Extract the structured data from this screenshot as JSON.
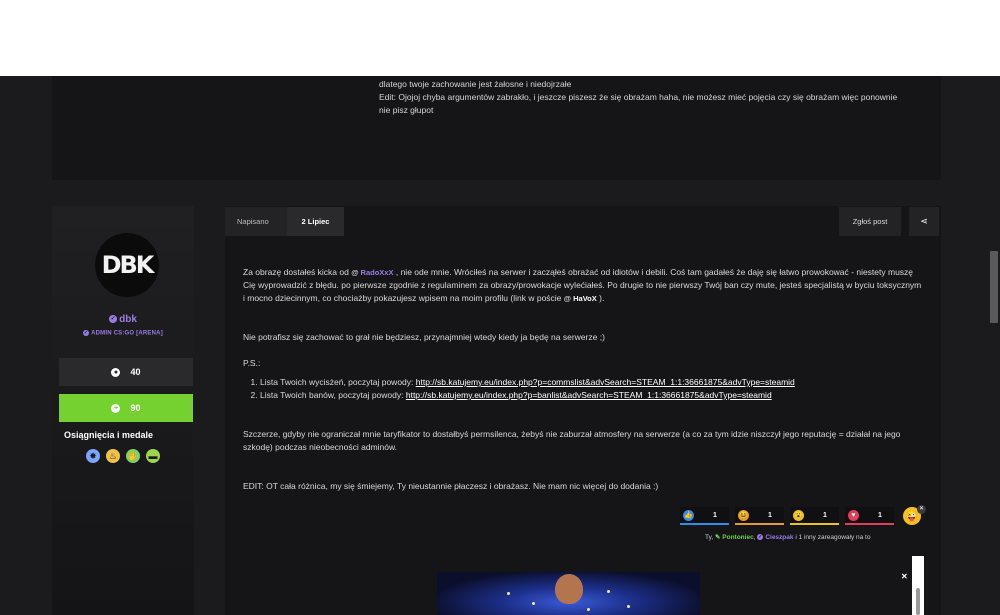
{
  "previous_post": {
    "lines": [
      "dlatego twoje zachowanie jest żałosne i niedojrzałe",
      "Edit: Ojojoj chyba argumentów zabrakło, i jeszcze piszesz że się obrażam haha, nie możesz mieć pojęcia czy się obrażam więc ponownie",
      "nie pisz głupot"
    ]
  },
  "author": {
    "avatar_text": "DBK",
    "name": "dbk",
    "rank": "ADMIN CS:GO [ARENA]",
    "posts_count": "40",
    "reputation": "90",
    "achievements_title": "Osiągnięcia i medale",
    "medals": [
      {
        "icon": "star-burst-icon",
        "color": "#7aa6ff"
      },
      {
        "icon": "flame-icon",
        "color": "#f0c24a"
      },
      {
        "icon": "hand-icon",
        "color": "#7fd06a"
      },
      {
        "icon": "chat-icon",
        "color": "#9ed64a"
      }
    ]
  },
  "post_meta": {
    "posted_label": "Napisano",
    "date": "2 Lipiec",
    "report_label": "Zgłoś post",
    "share_icon": "share-icon"
  },
  "content": {
    "p1_start": "Za obrazę dostałeś kicka od",
    "mention1": "RadoXxX",
    "p1_mid": ", nie ode mnie. Wróciłeś na serwer i zacząłeś obrażać od idiotów i debili. Coś tam gadałeś że daję się łatwo prowokować - niestety muszę Cię wyprowadzić z błędu. po pierwsze zgodnie z regulaminem za obrazy/prowokacje wylećiałeś. Po drugie to nie pierwszy Twój ban czy mute, jesteś specjalistą w byciu toksycznym i mocno dziecinnym, co chociażby pokazujesz wpisem na moim profilu (link w poście",
    "mention2": "HaVoX",
    "p1_end": ").",
    "p2": "Nie potrafisz się zachować to grał nie będziesz, przynajmniej wtedy kiedy ja będę na serwerze ;)",
    "ps_label": "P.S.:",
    "list": [
      {
        "label": "Lista Twoich wycisżeń, poczytaj powody: ",
        "url": "http://sb.katujemy.eu/index.php?p=commslist&advSearch=STEAM_1:1:36661875&advType=steamid"
      },
      {
        "label": "Lista Twoich banów, poczytaj powody: ",
        "url": "http://sb.katujemy.eu/index.php?p=banlist&advSearch=STEAM_1:1:36661875&advType=steamid"
      }
    ],
    "p3": "Szczerze, gdyby nie ograniczał mnie taryfikator to dostałbyś permsilenca, żebyś nie zaburzał atmosfery na serwerze (a co za tym idzie niszczył jego reputację = działał na jego szkodę) podczas nieobecności adminów.",
    "p4": "EDIT: OT cała różnica, my się śmiejemy, Ty nieustannie płaczesz i obrażasz. Nie mam nic więcej do dodania :)"
  },
  "reactions": [
    {
      "icon": "like-icon",
      "count": "1",
      "color": "#2e8ef0"
    },
    {
      "icon": "haha-icon",
      "count": "1",
      "color": "#e89b2c"
    },
    {
      "icon": "wow-icon",
      "count": "1",
      "color": "#e8c22c"
    },
    {
      "icon": "love-icon",
      "count": "1",
      "color": "#e23d5a"
    }
  ],
  "reacted_by": {
    "prefix": "Ty,",
    "user1": "Pontoniec",
    "user2": "Cieszpak",
    "suffix": "i 1 inny zareagowały na to"
  },
  "colors": {
    "accent_purple": "#9b7ce6",
    "reputation_green": "#74d12f",
    "background": "#1b1b1d"
  }
}
